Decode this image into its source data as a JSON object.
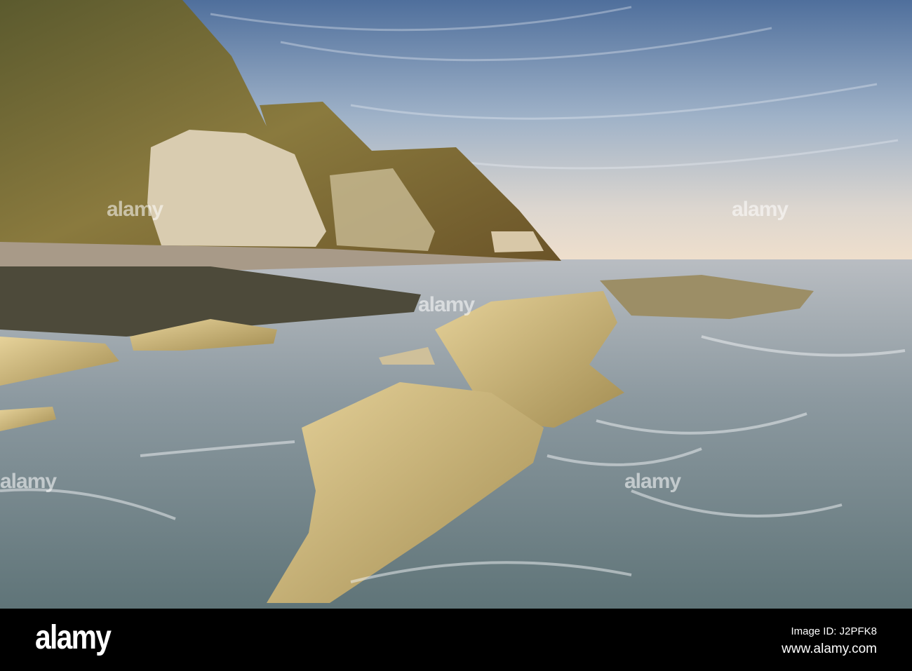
{
  "photo": {
    "subject": "Rocky coastline with cliffs at sunset",
    "watermark_text": "alamy"
  },
  "footer": {
    "logo_text": "alamy",
    "image_id": "Image ID: J2PFK8",
    "website": "www.alamy.com"
  }
}
